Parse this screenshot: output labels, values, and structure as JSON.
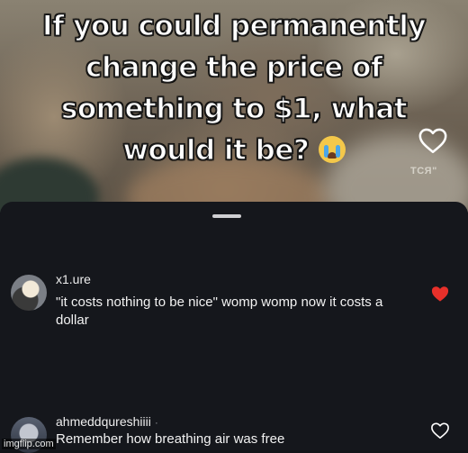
{
  "video": {
    "caption_text": "If you could permanently change the price of something to $1, what would it be?",
    "caption_emoji": "loudly-crying-face",
    "watermark": "TCЯ\""
  },
  "comments": [
    {
      "username": "x1.ure",
      "text": "\"it costs nothing to be nice\" womp womp now it costs a dollar",
      "liked": true,
      "heart_color": "#e8302a"
    },
    {
      "username": "ahmeddqureshiiii",
      "username_suffix": "·",
      "text": "Remember how breathing air was free",
      "liked": false
    }
  ],
  "footer": {
    "watermark": "imgflip.com"
  },
  "colors": {
    "sheet_background": "#15171c",
    "text": "#f2f2f2",
    "like_active": "#e8302a"
  }
}
